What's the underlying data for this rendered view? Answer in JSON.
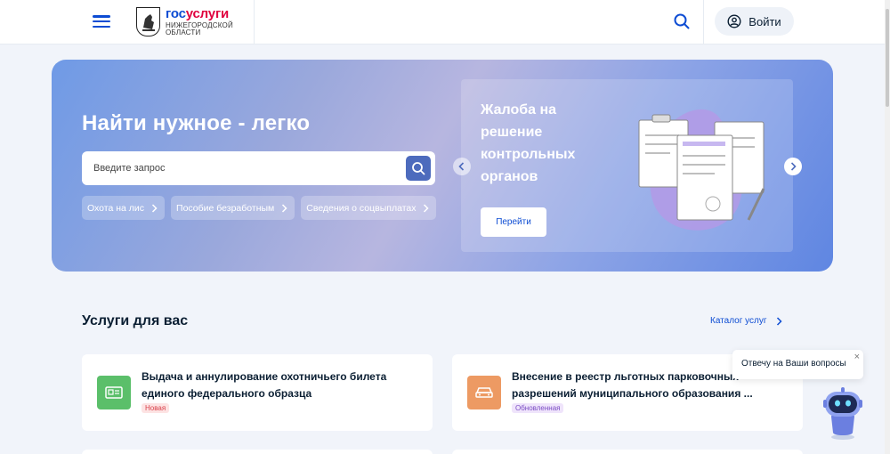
{
  "header": {
    "logo_main_gos": "гос",
    "logo_main_uslugi": "услуги",
    "logo_sub_line1": "Нижегородской",
    "logo_sub_line2": "области",
    "login_label": "Войти"
  },
  "banner": {
    "title": "Найти нужное - легко",
    "search_placeholder": "Введите запрос",
    "chips": [
      "Охота на лис",
      "Пособие безработным",
      "Сведения о соцвыплатах"
    ],
    "promo_title": "Жалоба на решение контрольных органов",
    "promo_button": "Перейти"
  },
  "services": {
    "title": "Услуги для вас",
    "catalog_link": "Каталог услуг",
    "cards": [
      {
        "title": "Выдача и аннулирование охотничьего билета единого федерального образца",
        "badge": "Новая",
        "icon": "id-card-icon",
        "icon_color": "#5bbf6a",
        "badge_bg": "#fde3e3",
        "badge_color": "#d9404a"
      },
      {
        "title": "Внесение в реестр льготных парковочных разрешений муниципального образования ...",
        "badge": "Обновленная",
        "icon": "car-icon",
        "icon_color": "#ed9a63",
        "badge_bg": "#efe4fb",
        "badge_color": "#7b4dc4"
      }
    ]
  },
  "chat": {
    "bubble_text": "Отвечу на Ваши вопросы",
    "close_label": "×"
  },
  "colors": {
    "brand_blue": "#0d4cd3",
    "brand_red": "#e0003f",
    "background": "#f1f4fa"
  }
}
